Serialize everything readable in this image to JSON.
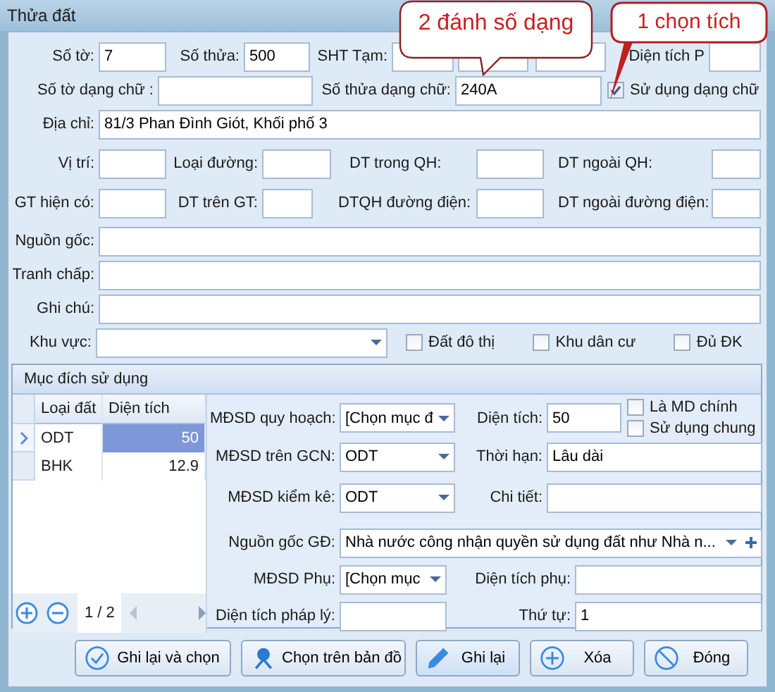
{
  "window": {
    "title": "Thửa đất"
  },
  "callouts": [
    {
      "text": "2 đánh số dạng"
    },
    {
      "text": "1 chọn tích"
    }
  ],
  "row1": {
    "so_to": {
      "label": "Số tờ:",
      "value": "7"
    },
    "so_thua": {
      "label": "Số thửa:",
      "value": "500"
    },
    "sht_tam": {
      "label": "SHT Tạm:"
    },
    "dien_tich_p": {
      "label": "Diện tích P"
    }
  },
  "row2": {
    "so_to_chu": {
      "label": "Số tờ dạng chữ :"
    },
    "so_thua_chu": {
      "label": "Số thửa dạng chữ:",
      "value": "240A"
    },
    "use_text": {
      "label": "Sử dụng dạng chữ",
      "checked": true
    }
  },
  "address": {
    "label": "Địa chỉ:",
    "value": "81/3 Phan Đình Giót, Khối phố 3"
  },
  "row4": [
    "Vị trí:",
    "Loại đường:",
    "DT trong QH:",
    "DT ngoài QH:"
  ],
  "row5": [
    "GT hiện có:",
    "DT trên GT:",
    "DTQH đường điện:",
    "DT ngoài đường điện:"
  ],
  "long_fields": [
    "Nguồn gốc:",
    "Tranh chấp:",
    "Ghi chú:"
  ],
  "area": {
    "label": "Khu vực:",
    "checks": [
      {
        "label": "Đất đô thị",
        "checked": false
      },
      {
        "label": "Khu dân cư",
        "checked": false
      },
      {
        "label": "Đủ ĐK",
        "checked": false
      }
    ]
  },
  "usage": {
    "title": "Mục đích sử dụng",
    "table": {
      "columns": [
        "Loại đất",
        "Diện tích"
      ],
      "rows": [
        {
          "cells": [
            "ODT",
            "50"
          ],
          "selected": true
        },
        {
          "cells": [
            "BHK",
            "12.9"
          ],
          "selected": false
        }
      ],
      "page": "1 / 2"
    },
    "mdsd_qh": {
      "label": "MĐSD quy hoạch:",
      "value": "[Chọn mục đ"
    },
    "dien_tich": {
      "label": "Diện tích:",
      "value": "50"
    },
    "checks": [
      {
        "label": "Là MD chính",
        "checked": false
      },
      {
        "label": "Sử dụng chung",
        "checked": false
      }
    ],
    "mdsd_gcn": {
      "label": "MĐSD trên GCN:",
      "value": "ODT"
    },
    "thoi_han": {
      "label": "Thời hạn:",
      "value": "Lâu dài"
    },
    "mdsd_kk": {
      "label": "MĐSD kiểm kê:",
      "value": "ODT"
    },
    "chi_tiet": {
      "label": "Chi tiết:"
    },
    "nguon_goc": {
      "label": "Nguồn gốc GĐ:",
      "value": "Nhà nước công nhận quyền sử dụng đất như Nhà n..."
    },
    "mdsd_phu": {
      "label": "MĐSD Phụ:",
      "value": "[Chọn mục"
    },
    "dt_phu": {
      "label": "Diện tích phụ:"
    },
    "dt_phap_ly": {
      "label": "Diện tích pháp lý:"
    },
    "thu_tu": {
      "label": "Thứ tự:",
      "value": "1"
    }
  },
  "buttons": [
    {
      "kind": "check",
      "label": "Ghi lại và chọn"
    },
    {
      "kind": "map",
      "label": "Chọn trên bản đồ"
    },
    {
      "kind": "pencil",
      "label": "Ghi lại"
    },
    {
      "kind": "plus",
      "label": "Xóa"
    },
    {
      "kind": "ban",
      "label": "Đóng"
    }
  ]
}
